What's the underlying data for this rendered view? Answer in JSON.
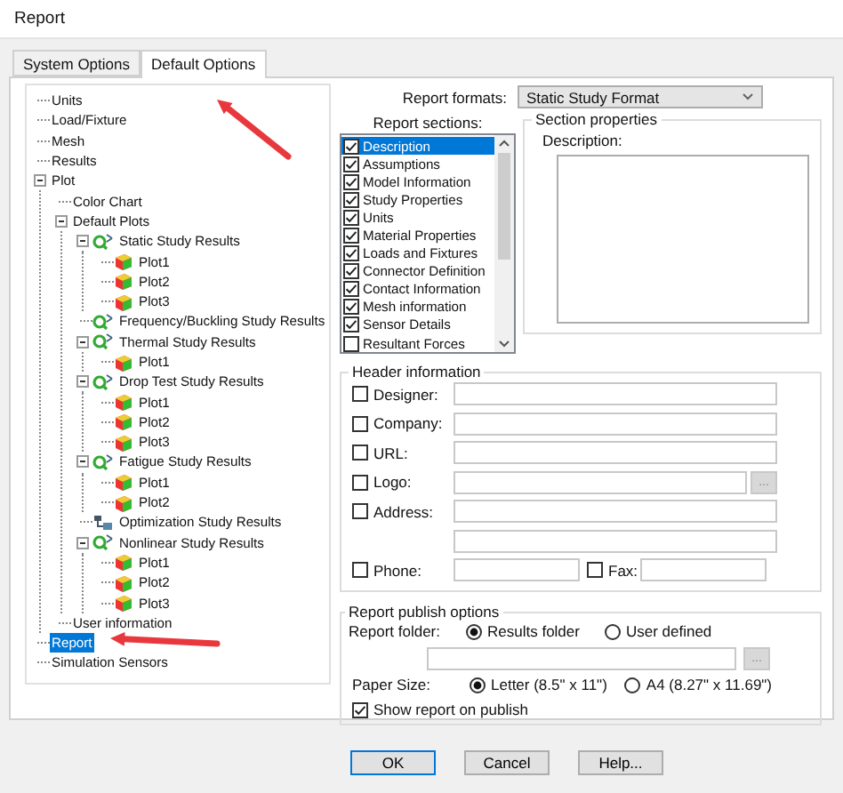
{
  "window": {
    "title": "Report"
  },
  "tabs": [
    {
      "label": "System Options",
      "selected": false
    },
    {
      "label": "Default Options",
      "selected": true
    }
  ],
  "tree": [
    {
      "label": "Units",
      "selected": false
    },
    {
      "label": "Load/Fixture",
      "selected": false
    },
    {
      "label": "Mesh",
      "selected": false
    },
    {
      "label": "Results",
      "selected": false
    },
    {
      "label": "Plot",
      "selected": false,
      "expanded": true,
      "children": [
        {
          "label": "Color Chart",
          "selected": false
        },
        {
          "label": "Default Plots",
          "selected": false,
          "expanded": true,
          "children": [
            {
              "label": "Static Study Results",
              "kind": "study",
              "selected": false,
              "expanded": true,
              "children": [
                {
                  "label": "Plot1",
                  "kind": "plot",
                  "selected": false
                },
                {
                  "label": "Plot2",
                  "kind": "plot",
                  "selected": false
                },
                {
                  "label": "Plot3",
                  "kind": "plot",
                  "selected": false
                }
              ]
            },
            {
              "label": "Frequency/Buckling Study Results",
              "kind": "study",
              "selected": false
            },
            {
              "label": "Thermal Study Results",
              "kind": "study",
              "selected": false,
              "expanded": true,
              "children": [
                {
                  "label": "Plot1",
                  "kind": "plot",
                  "selected": false
                }
              ]
            },
            {
              "label": "Drop Test Study Results",
              "kind": "study",
              "selected": false,
              "expanded": true,
              "children": [
                {
                  "label": "Plot1",
                  "kind": "plot",
                  "selected": false
                },
                {
                  "label": "Plot2",
                  "kind": "plot",
                  "selected": false
                },
                {
                  "label": "Plot3",
                  "kind": "plot",
                  "selected": false
                }
              ]
            },
            {
              "label": "Fatigue Study Results",
              "kind": "study",
              "selected": false,
              "expanded": true,
              "children": [
                {
                  "label": "Plot1",
                  "kind": "plot",
                  "selected": false
                },
                {
                  "label": "Plot2",
                  "kind": "plot",
                  "selected": false
                }
              ]
            },
            {
              "label": "Optimization Study Results",
              "kind": "optimization",
              "selected": false
            },
            {
              "label": "Nonlinear Study Results",
              "kind": "study",
              "selected": false,
              "expanded": true,
              "children": [
                {
                  "label": "Plot1",
                  "kind": "plot",
                  "selected": false
                },
                {
                  "label": "Plot2",
                  "kind": "plot",
                  "selected": false
                },
                {
                  "label": "Plot3",
                  "kind": "plot",
                  "selected": false
                }
              ]
            }
          ]
        },
        {
          "label": "User information",
          "selected": false
        }
      ]
    },
    {
      "label": "Report",
      "selected": true
    },
    {
      "label": "Simulation Sensors",
      "selected": false
    }
  ],
  "report_formats": {
    "label": "Report formats:",
    "value": "Static Study Format"
  },
  "report_sections": {
    "label": "Report sections:",
    "items": [
      {
        "label": "Description",
        "checked": true,
        "selected": true
      },
      {
        "label": "Assumptions",
        "checked": true,
        "selected": false
      },
      {
        "label": "Model Information",
        "checked": true,
        "selected": false
      },
      {
        "label": "Study Properties",
        "checked": true,
        "selected": false
      },
      {
        "label": "Units",
        "checked": true,
        "selected": false
      },
      {
        "label": "Material Properties",
        "checked": true,
        "selected": false
      },
      {
        "label": "Loads and Fixtures",
        "checked": true,
        "selected": false
      },
      {
        "label": "Connector Definition",
        "checked": true,
        "selected": false
      },
      {
        "label": "Contact Information",
        "checked": true,
        "selected": false
      },
      {
        "label": "Mesh information",
        "checked": true,
        "selected": false
      },
      {
        "label": "Sensor Details",
        "checked": true,
        "selected": false
      },
      {
        "label": "Resultant Forces",
        "checked": false,
        "selected": false
      }
    ]
  },
  "section_properties": {
    "title": "Section properties",
    "description_label": "Description:"
  },
  "header_information": {
    "title": "Header information",
    "fields": [
      {
        "label": "Designer:",
        "checked": false,
        "kind": "text"
      },
      {
        "label": "Company:",
        "checked": false,
        "kind": "text"
      },
      {
        "label": "URL:",
        "checked": false,
        "kind": "text"
      },
      {
        "label": "Logo:",
        "checked": false,
        "kind": "browse",
        "browse_label": "..."
      },
      {
        "label": "Address:",
        "checked": false,
        "kind": "double"
      },
      {
        "label": "Phone:",
        "checked": false,
        "kind": "split",
        "fax": {
          "label": "Fax:",
          "checked": false
        }
      }
    ]
  },
  "publish_options": {
    "title": "Report publish options",
    "folder_label": "Report folder:",
    "folder_options": [
      {
        "label": "Results folder",
        "selected": true
      },
      {
        "label": "User defined",
        "selected": false
      }
    ],
    "browse_label": "...",
    "paper_label": "Paper Size:",
    "paper_options": [
      {
        "label": "Letter (8.5\" x 11\")",
        "selected": true
      },
      {
        "label": "A4 (8.27\" x 11.69\")",
        "selected": false
      }
    ],
    "show_report": {
      "label": "Show report on publish",
      "checked": true
    }
  },
  "buttons": [
    {
      "label": "OK",
      "default": true
    },
    {
      "label": "Cancel",
      "default": false
    },
    {
      "label": "Help...",
      "default": false
    }
  ]
}
